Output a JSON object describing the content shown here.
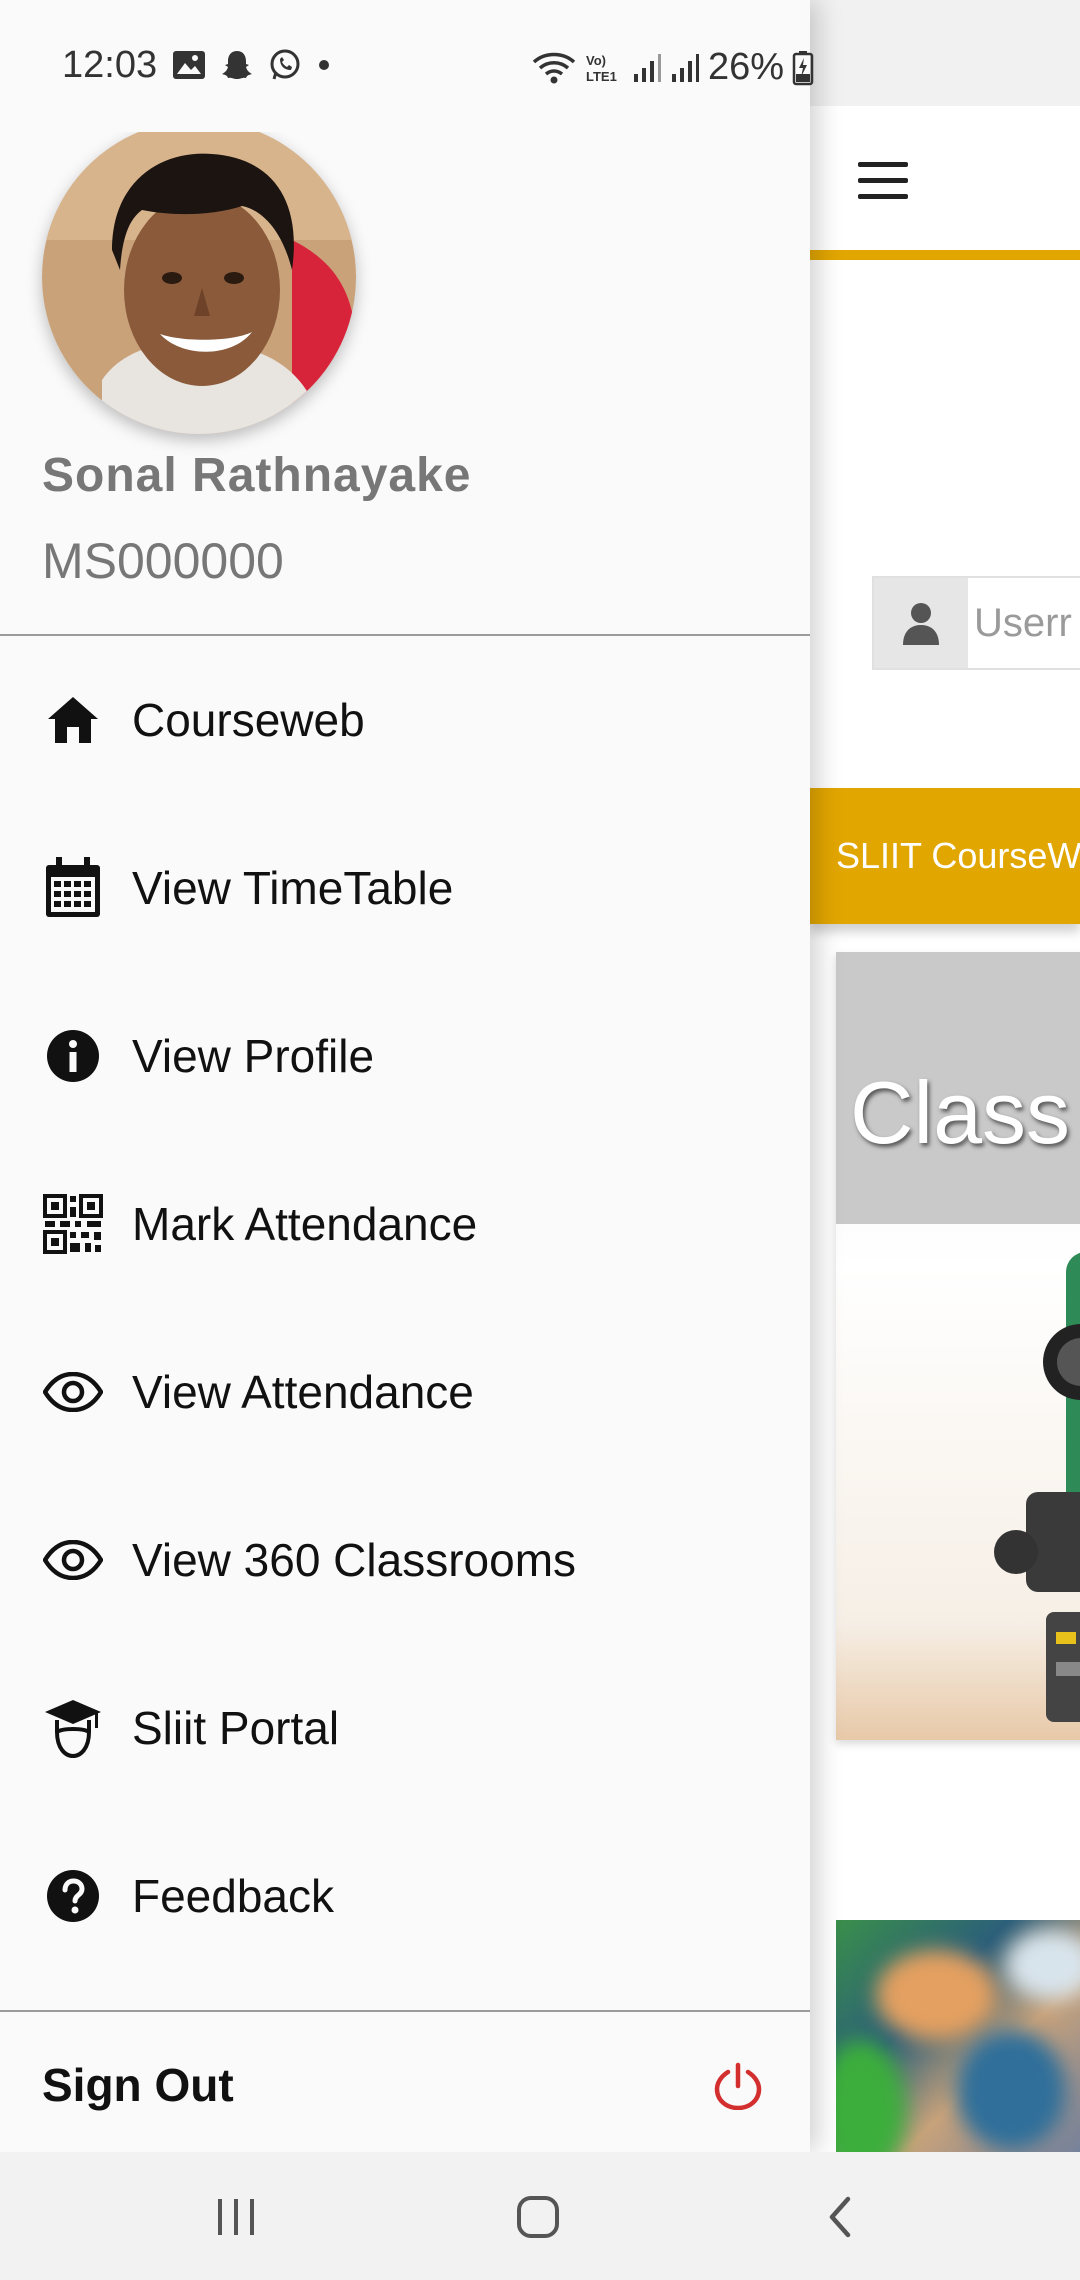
{
  "status_bar": {
    "time": "12:03",
    "battery": "26%",
    "left_icons": [
      "gallery-icon",
      "snapchat-icon",
      "whatsapp-icon",
      "dot-icon"
    ],
    "right_icons": [
      "wifi-icon",
      "volte-icon",
      "signal-icon",
      "signal-icon",
      "battery-icon"
    ]
  },
  "drawer": {
    "user": {
      "name": "Sonal Rathnayake",
      "id": "MS000000"
    },
    "menu": [
      {
        "label": "Courseweb",
        "icon": "home-icon"
      },
      {
        "label": "View TimeTable",
        "icon": "calendar-icon"
      },
      {
        "label": "View Profile",
        "icon": "info-icon"
      },
      {
        "label": "Mark Attendance",
        "icon": "qr-code-icon"
      },
      {
        "label": "View Attendance",
        "icon": "eye-icon"
      },
      {
        "label": "View 360 Classrooms",
        "icon": "eye-icon"
      },
      {
        "label": "Sliit Portal",
        "icon": "graduation-cap-icon"
      },
      {
        "label": "Feedback",
        "icon": "help-icon"
      }
    ],
    "sign_out": {
      "label": "Sign Out",
      "icon": "power-icon",
      "icon_color": "#d32f2f"
    }
  },
  "background_app": {
    "accent_color": "#e2a600",
    "username_placeholder": "Userr",
    "banner_text": "SLIIT CourseW",
    "card_title": "Class"
  },
  "nav_bar": {
    "buttons": [
      "recent-apps-icon",
      "home-icon",
      "back-icon"
    ]
  }
}
